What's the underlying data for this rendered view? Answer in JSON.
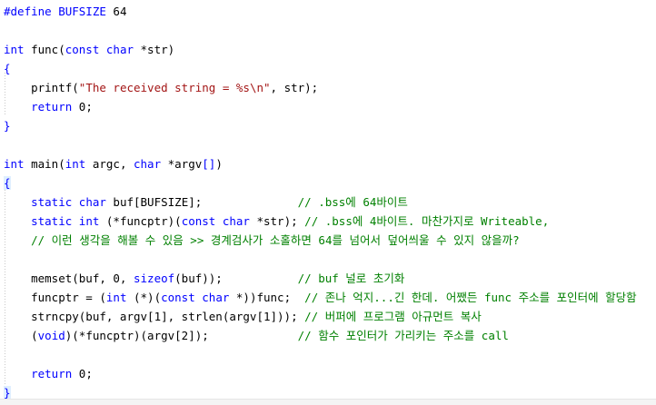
{
  "code_lines": [
    [
      {
        "t": "#define BUFSIZE ",
        "c": "pp"
      },
      {
        "t": "64",
        "c": "plain"
      }
    ],
    [],
    [
      {
        "t": "int",
        "c": "kw"
      },
      {
        "t": " func(",
        "c": "plain"
      },
      {
        "t": "const char",
        "c": "kw"
      },
      {
        "t": " *str)",
        "c": "plain"
      }
    ],
    [
      {
        "t": "{",
        "c": "kw"
      }
    ],
    [
      {
        "t": "    printf(",
        "c": "plain"
      },
      {
        "t": "\"The received string = %s\\n\"",
        "c": "str"
      },
      {
        "t": ", str);",
        "c": "plain"
      }
    ],
    [
      {
        "t": "    ",
        "c": "plain"
      },
      {
        "t": "return",
        "c": "kw"
      },
      {
        "t": " 0;",
        "c": "plain"
      }
    ],
    [
      {
        "t": "}",
        "c": "kw"
      }
    ],
    [],
    [
      {
        "t": "int",
        "c": "kw"
      },
      {
        "t": " main(",
        "c": "plain"
      },
      {
        "t": "int",
        "c": "kw"
      },
      {
        "t": " argc, ",
        "c": "plain"
      },
      {
        "t": "char",
        "c": "kw"
      },
      {
        "t": " *argv",
        "c": "plain"
      },
      {
        "t": "[]",
        "c": "kw"
      },
      {
        "t": ")",
        "c": "plain"
      }
    ],
    [
      {
        "t": "{",
        "c": "kw hl"
      }
    ],
    [
      {
        "t": "    ",
        "c": "plain"
      },
      {
        "t": "static char",
        "c": "kw"
      },
      {
        "t": " buf[BUFSIZE];              ",
        "c": "plain"
      },
      {
        "t": "// .bss에 64바이트",
        "c": "cm"
      }
    ],
    [
      {
        "t": "    ",
        "c": "plain"
      },
      {
        "t": "static int",
        "c": "kw"
      },
      {
        "t": " (*funcptr)(",
        "c": "plain"
      },
      {
        "t": "const char",
        "c": "kw"
      },
      {
        "t": " *str); ",
        "c": "plain"
      },
      {
        "t": "// .bss에 4바이트. 마찬가지로 Writeable,",
        "c": "cm"
      }
    ],
    [
      {
        "t": "    // 이런 생각을 해볼 수 있음 >> 경계검사가 소홀하면 64를 넘어서 덮어씌울 수 있지 않을까?",
        "c": "cm"
      }
    ],
    [],
    [
      {
        "t": "    memset(buf, 0, ",
        "c": "plain"
      },
      {
        "t": "sizeof",
        "c": "kw"
      },
      {
        "t": "(buf));           ",
        "c": "plain"
      },
      {
        "t": "// buf 널로 초기화",
        "c": "cm"
      }
    ],
    [
      {
        "t": "    funcptr = (",
        "c": "plain"
      },
      {
        "t": "int",
        "c": "kw"
      },
      {
        "t": " (*)(",
        "c": "plain"
      },
      {
        "t": "const char",
        "c": "kw"
      },
      {
        "t": " *))func;  ",
        "c": "plain"
      },
      {
        "t": "// 존나 억지...긴 한데. 어쨌든 func 주소를 포인터에 할당함",
        "c": "cm"
      }
    ],
    [
      {
        "t": "    strncpy(buf, argv[1], strlen(argv[1])); ",
        "c": "plain"
      },
      {
        "t": "// 버퍼에 프로그램 아규먼트 복사",
        "c": "cm"
      }
    ],
    [
      {
        "t": "    (",
        "c": "plain"
      },
      {
        "t": "void",
        "c": "kw"
      },
      {
        "t": ")(*funcptr)(argv[2]);             ",
        "c": "plain"
      },
      {
        "t": "// 함수 포인터가 가리키는 주소를 call",
        "c": "cm"
      }
    ],
    [],
    [
      {
        "t": "    ",
        "c": "plain"
      },
      {
        "t": "return",
        "c": "kw"
      },
      {
        "t": " 0;",
        "c": "plain"
      }
    ],
    [
      {
        "t": "}",
        "c": "kw hl"
      }
    ]
  ]
}
